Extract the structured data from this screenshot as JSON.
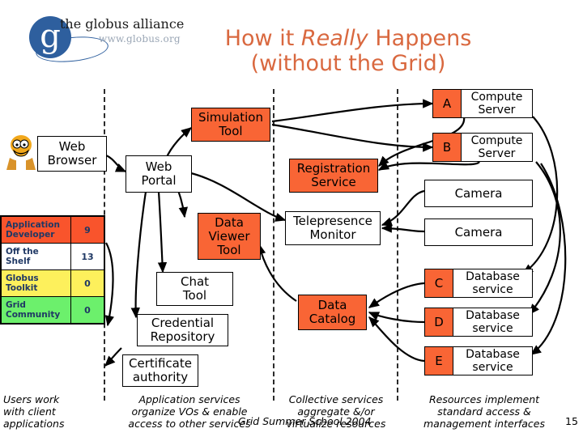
{
  "brand": {
    "logo_letter": "g",
    "name": "the globus alliance",
    "url": "www.globus.org"
  },
  "title": {
    "line1_a": "How it ",
    "line1_em": "Really",
    "line1_b": " Happens",
    "line2": "(without the Grid)"
  },
  "colors": {
    "accent_orange": "#f96535",
    "title_orange": "#d9683f",
    "brand_blue": "#2e5f9e",
    "band_blue": "#4a7db5",
    "stat_red": "#f9542c",
    "stat_yellow": "#fdf05c",
    "stat_green": "#6cf06c",
    "stat_text": "#1f3864"
  },
  "nodes": {
    "web_browser": "Web\nBrowser",
    "web_browser_l1": "Web",
    "web_browser_l2": "Browser",
    "web_portal_l1": "Web",
    "web_portal_l2": "Portal",
    "simulation_tool_l1": "Simulation",
    "simulation_tool_l2": "Tool",
    "data_viewer_l1": "Data",
    "data_viewer_l2": "Viewer",
    "data_viewer_l3": "Tool",
    "chat_tool_l1": "Chat",
    "chat_tool_l2": "Tool",
    "credential_repository_l1": "Credential",
    "credential_repository_l2": "Repository",
    "certificate_authority_l1": "Certificate",
    "certificate_authority_l2": "authority",
    "registration_service_l1": "Registration",
    "registration_service_l2": "Service",
    "telepresence_monitor_l1": "Telepresence",
    "telepresence_monitor_l2": "Monitor",
    "data_catalog_l1": "Data",
    "data_catalog_l2": "Catalog"
  },
  "resources": [
    {
      "tag": "A",
      "label_l1": "Compute",
      "label_l2": "Server",
      "tagged": true
    },
    {
      "tag": "B",
      "label_l1": "Compute",
      "label_l2": "Server",
      "tagged": true
    },
    {
      "tag": "",
      "label_l1": "Camera",
      "label_l2": "",
      "tagged": false
    },
    {
      "tag": "",
      "label_l1": "Camera",
      "label_l2": "",
      "tagged": false
    },
    {
      "tag": "C",
      "label_l1": "Database",
      "label_l2": "service",
      "tagged": true
    },
    {
      "tag": "D",
      "label_l1": "Database",
      "label_l2": "service",
      "tagged": true
    },
    {
      "tag": "E",
      "label_l1": "Database",
      "label_l2": "service",
      "tagged": true
    }
  ],
  "stats": {
    "rows": [
      {
        "label_l1": "Application",
        "label_l2": "Developer",
        "count": "9"
      },
      {
        "label_l1": "Off the",
        "label_l2": "Shelf",
        "count": "13"
      },
      {
        "label_l1": "Globus",
        "label_l2": "Toolkit",
        "count": "0"
      },
      {
        "label_l1": "Grid",
        "label_l2": "Community",
        "count": "0"
      }
    ]
  },
  "captions": [
    {
      "l1": "Users work",
      "l2": "with client",
      "l3": "applications"
    },
    {
      "l1": "Application services",
      "l2": "organize VOs & enable",
      "l3": "access to other services"
    },
    {
      "l1": "Collective services",
      "l2": "aggregate &/or",
      "l3": "virtualize resources"
    },
    {
      "l1": "Resources implement",
      "l2": "standard access &",
      "l3": "management interfaces"
    }
  ],
  "footer": {
    "event": "Grid Summer School 2004",
    "page": "15"
  }
}
